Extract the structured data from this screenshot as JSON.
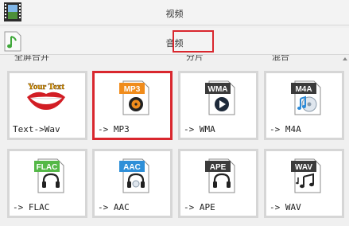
{
  "tabs": {
    "video_label": "视频",
    "audio_label": "音频"
  },
  "partial_row": [
    "全屏合并",
    "分片",
    "混合"
  ],
  "cards": [
    {
      "format": "",
      "label": "Text->Wav",
      "badge_color": "",
      "icon": "lips-your-text-icon",
      "badge_text": "Your Text"
    },
    {
      "format": "MP3",
      "label": "-> MP3",
      "badge_color": "#f08c1c",
      "icon": "mp3-file-icon"
    },
    {
      "format": "WMA",
      "label": "-> WMA",
      "badge_color": "#3b3b3b",
      "icon": "wma-file-icon"
    },
    {
      "format": "M4A",
      "label": "-> M4A",
      "badge_color": "#3b3b3b",
      "icon": "m4a-file-icon"
    },
    {
      "format": "FLAC",
      "label": "-> FLAC",
      "badge_color": "#54b847",
      "icon": "flac-file-icon"
    },
    {
      "format": "AAC",
      "label": "-> AAC",
      "badge_color": "#2e8fd8",
      "icon": "aac-file-icon"
    },
    {
      "format": "APE",
      "label": "-> APE",
      "badge_color": "#3b3b3b",
      "icon": "ape-file-icon"
    },
    {
      "format": "WAV",
      "label": "-> WAV",
      "badge_color": "#3b3b3b",
      "icon": "wav-file-icon"
    }
  ],
  "selected_card": 1,
  "colors": {
    "highlight": "#d9272e",
    "card_border": "#d6d6d6"
  }
}
